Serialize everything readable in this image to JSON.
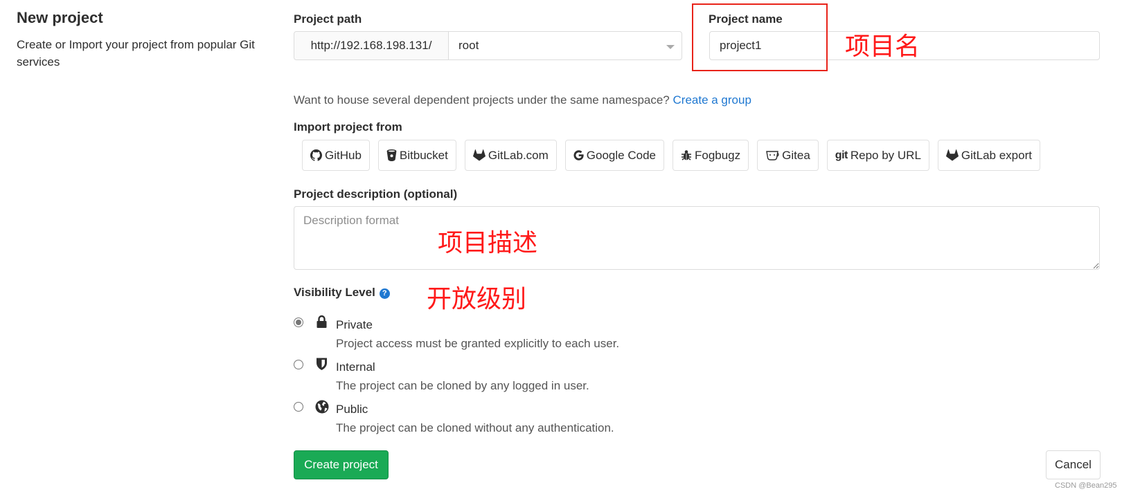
{
  "page": {
    "title": "New project",
    "description": "Create or Import your project from popular Git services"
  },
  "project_path": {
    "label": "Project path",
    "prefix": "http://192.168.198.131/",
    "namespace": "root"
  },
  "project_name": {
    "label": "Project name",
    "value": "project1"
  },
  "group_hint": {
    "text": "Want to house several dependent projects under the same namespace?",
    "link": "Create a group"
  },
  "import": {
    "label": "Import project from",
    "sources": [
      {
        "label": "GitHub",
        "icon": "github-icon"
      },
      {
        "label": "Bitbucket",
        "icon": "bitbucket-icon"
      },
      {
        "label": "GitLab.com",
        "icon": "gitlab-icon"
      },
      {
        "label": "Google Code",
        "icon": "google-icon"
      },
      {
        "label": "Fogbugz",
        "icon": "bug-icon"
      },
      {
        "label": "Gitea",
        "icon": "gitea-icon"
      },
      {
        "label": "Repo by URL",
        "icon": "git-icon",
        "icon_text": "git"
      },
      {
        "label": "GitLab export",
        "icon": "gitlab-icon"
      }
    ]
  },
  "description": {
    "label": "Project description (optional)",
    "placeholder": "Description format"
  },
  "visibility": {
    "label": "Visibility Level",
    "selected": "private",
    "options": [
      {
        "id": "private",
        "title": "Private",
        "desc": "Project access must be granted explicitly to each user.",
        "icon": "lock-icon"
      },
      {
        "id": "internal",
        "title": "Internal",
        "desc": "The project can be cloned by any logged in user.",
        "icon": "shield-icon"
      },
      {
        "id": "public",
        "title": "Public",
        "desc": "The project can be cloned without any authentication.",
        "icon": "globe-icon"
      }
    ]
  },
  "buttons": {
    "create": "Create project",
    "cancel": "Cancel"
  },
  "annotations": {
    "name": "项目名",
    "description": "项目描述",
    "visibility": "开放级别"
  },
  "watermark": "CSDN @Bean295",
  "colors": {
    "primary_green": "#1aaa55",
    "link_blue": "#1f78d1",
    "annotation_red": "#ff1a1a"
  }
}
